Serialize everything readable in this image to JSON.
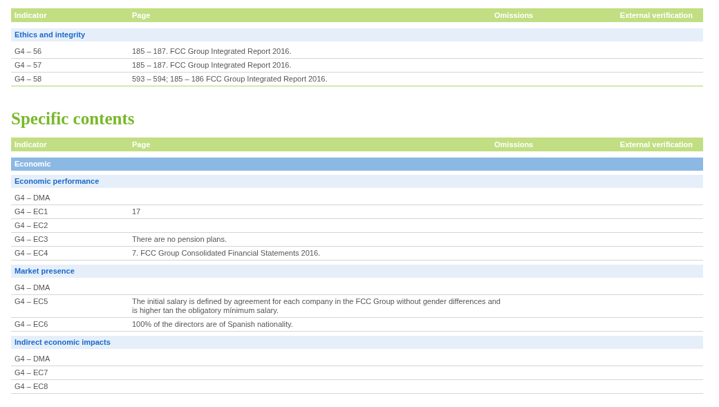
{
  "tables": [
    {
      "columns": [
        "Indicator",
        "Page",
        "Omissions",
        "External verification"
      ],
      "items": [
        {
          "kind": "section",
          "title": "Ethics and integrity"
        },
        {
          "kind": "row",
          "indicator": "G4 – 56",
          "page": "185 – 187. FCC Group Integrated Report 2016."
        },
        {
          "kind": "row",
          "indicator": "G4 – 57",
          "page": "185 – 187. FCC Group Integrated Report 2016."
        },
        {
          "kind": "row",
          "indicator": "G4 – 58",
          "page": "593 – 594; 185 – 186 FCC Group Integrated Report 2016."
        }
      ]
    },
    {
      "heading": "Specific contents",
      "columns": [
        "Indicator",
        "Page",
        "Omissions",
        "External verification"
      ],
      "items": [
        {
          "kind": "category",
          "title": "Economic"
        },
        {
          "kind": "section",
          "title": "Economic performance"
        },
        {
          "kind": "row",
          "indicator": "G4 – DMA"
        },
        {
          "kind": "row",
          "indicator": "G4 – EC1",
          "page": "17"
        },
        {
          "kind": "row",
          "indicator": "G4 – EC2"
        },
        {
          "kind": "row",
          "indicator": "G4 – EC3",
          "page": "There are no pension plans."
        },
        {
          "kind": "row",
          "indicator": "G4 – EC4",
          "page": "7. FCC Group Consolidated Financial Statements 2016."
        },
        {
          "kind": "section",
          "title": "Market presence"
        },
        {
          "kind": "row",
          "indicator": "G4 – DMA"
        },
        {
          "kind": "row",
          "indicator": "G4 – EC5",
          "page": "The initial salary is defined by agreement for each company in the FCC Group without gender differences and is higher tan the obligatory mínimum salary."
        },
        {
          "kind": "row",
          "indicator": "G4 – EC6",
          "page": "100% of the directors are of Spanish nationality."
        },
        {
          "kind": "section",
          "title": "Indirect economic impacts"
        },
        {
          "kind": "row",
          "indicator": "G4 – DMA"
        },
        {
          "kind": "row",
          "indicator": "G4 – EC7"
        },
        {
          "kind": "row",
          "indicator": "G4 – EC8"
        }
      ]
    }
  ]
}
